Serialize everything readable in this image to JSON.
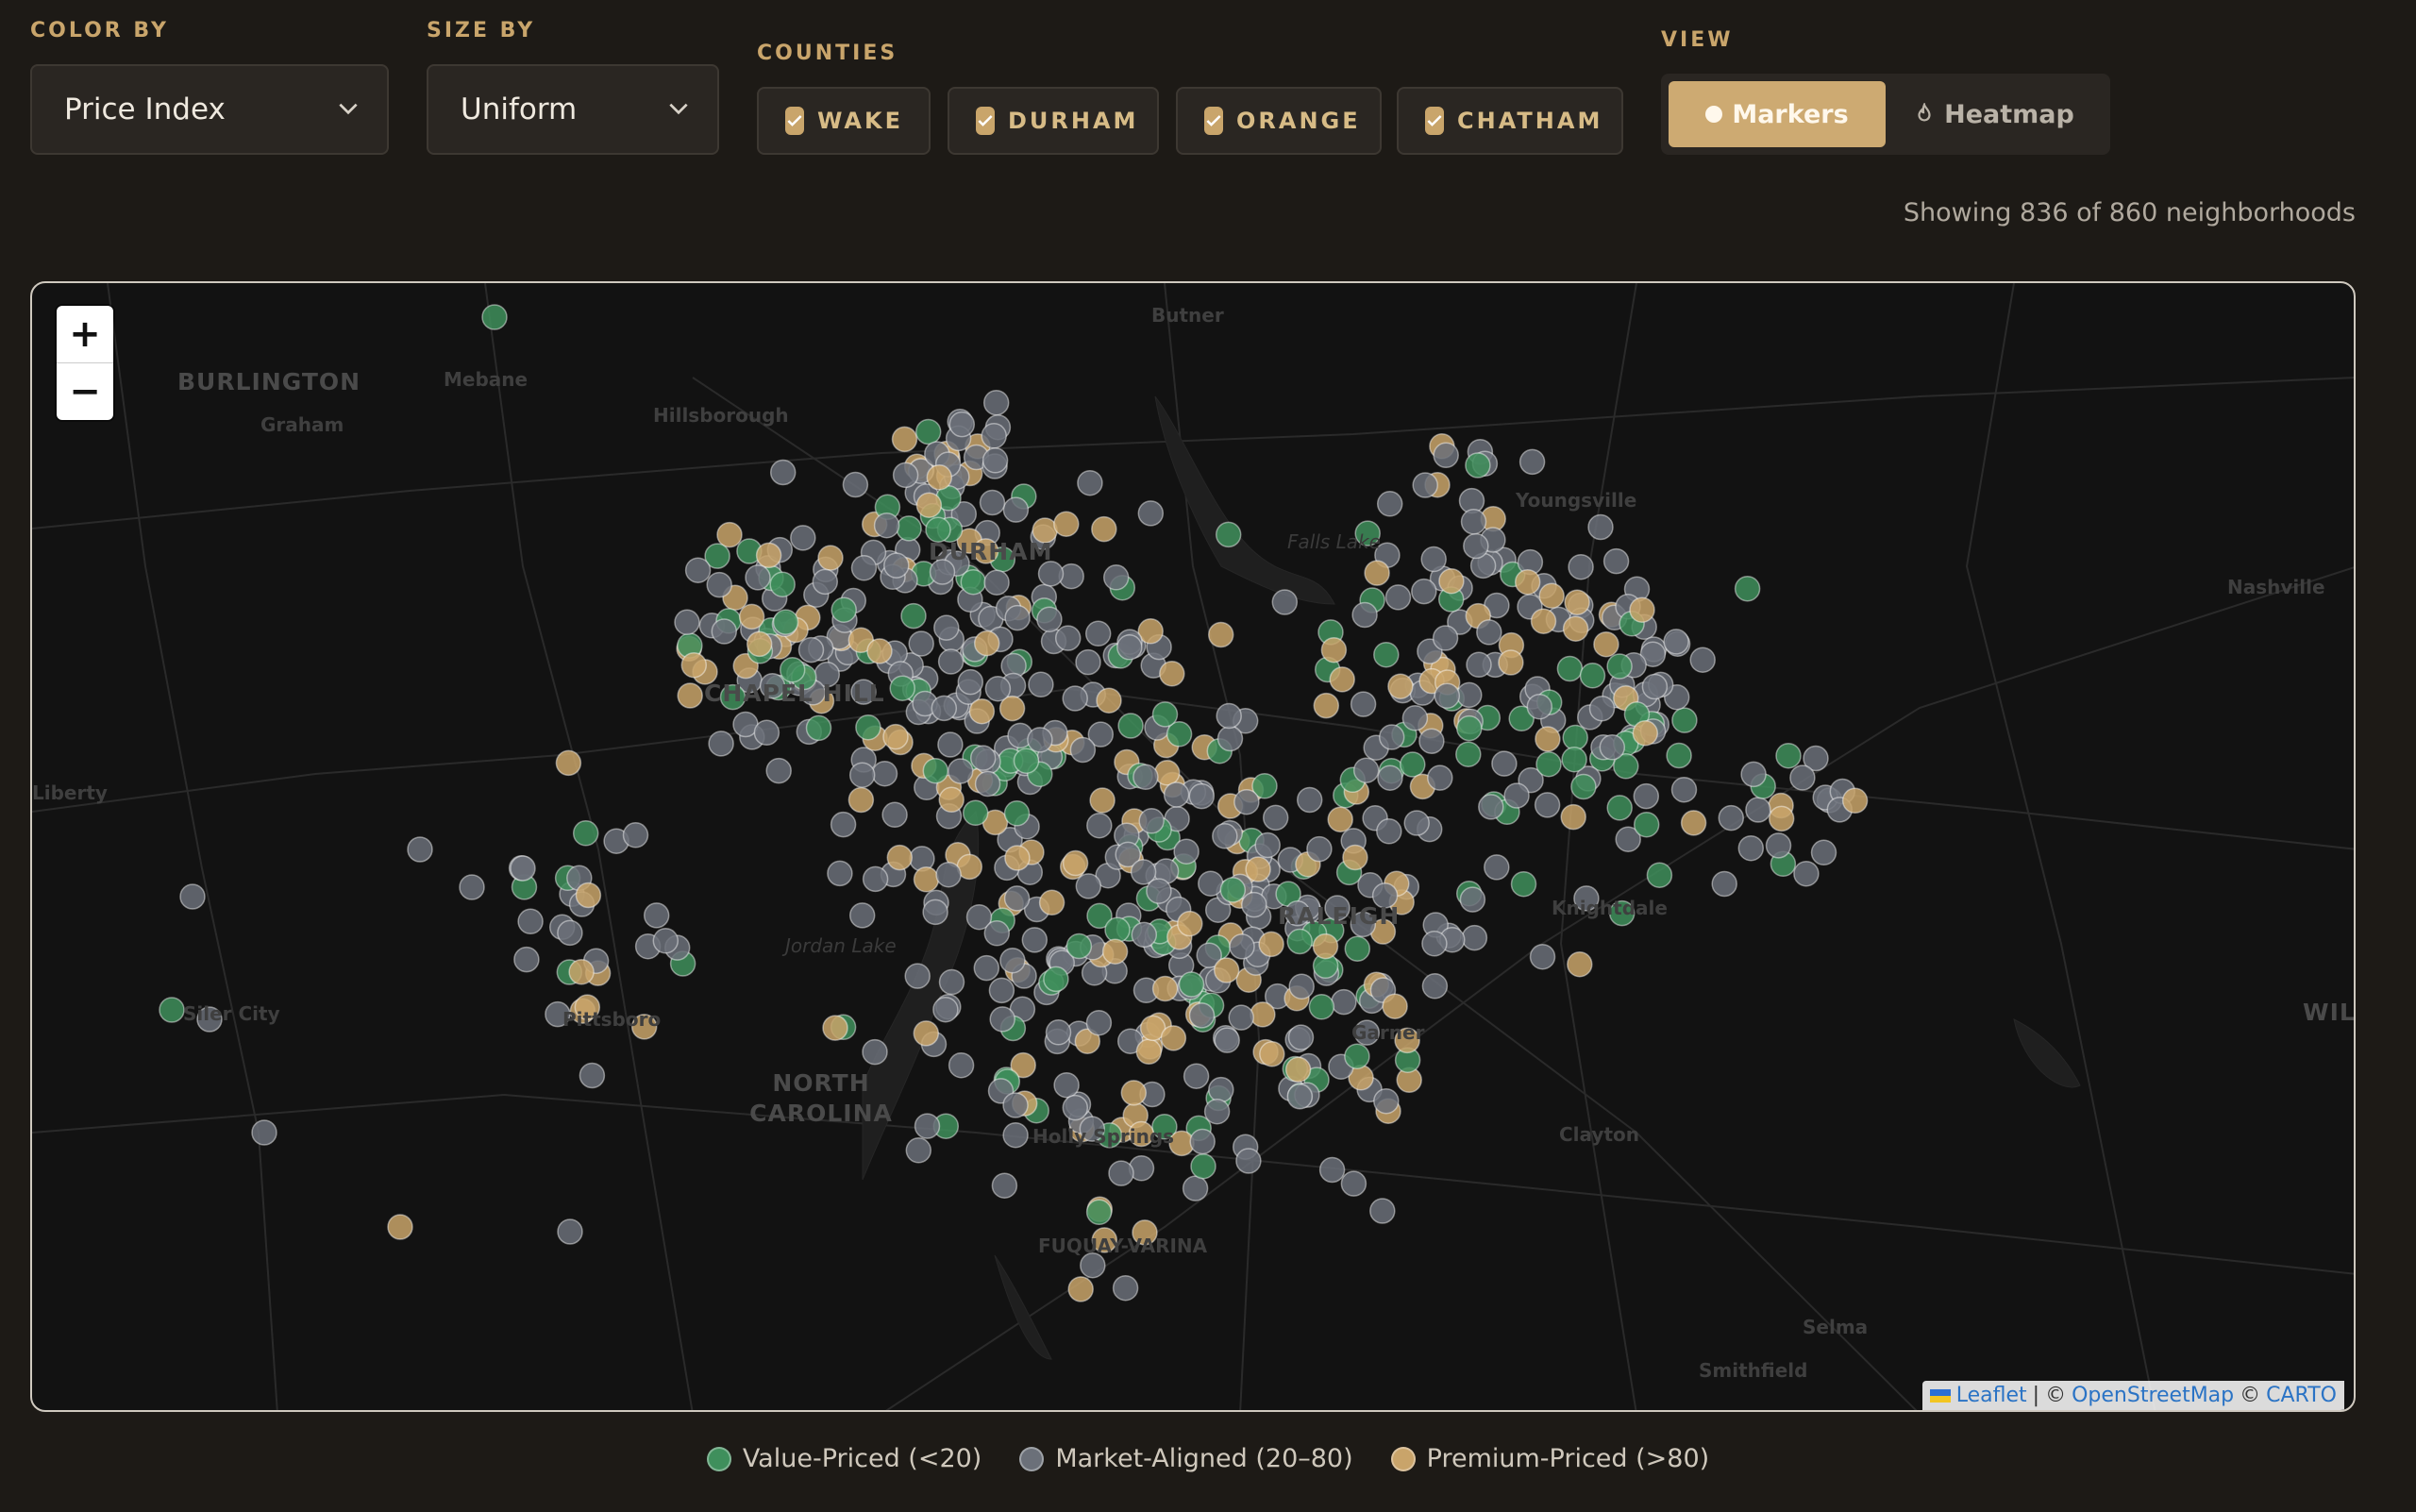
{
  "controls": {
    "color_by": {
      "label": "COLOR BY",
      "value": "Price Index"
    },
    "size_by": {
      "label": "SIZE BY",
      "value": "Uniform"
    },
    "counties": {
      "label": "COUNTIES",
      "items": [
        "WAKE",
        "DURHAM",
        "ORANGE",
        "CHATHAM"
      ]
    },
    "view": {
      "label": "VIEW",
      "markers": "Markers",
      "heatmap": "Heatmap",
      "active": "Markers"
    }
  },
  "status": {
    "count_text": "Showing 836 of 860 neighborhoods"
  },
  "map": {
    "zoom_in": "+",
    "zoom_out": "−",
    "attribution": {
      "leaflet": "Leaflet",
      "sep": "|",
      "copy1": "©",
      "osm": "OpenStreetMap",
      "copy2": "©",
      "carto": "CARTO"
    },
    "places": [
      "Butner",
      "BURLINGTON",
      "Graham",
      "Mebane",
      "Hillsborough",
      "Youngsville",
      "Falls Lake",
      "Nashville",
      "Liberty",
      "CHAPEL HILL",
      "DURHAM",
      "RALEIGH",
      "Jordan Lake",
      "Siler City",
      "Pittsboro",
      "NORTH CAROLINA",
      "Garner",
      "Clayton",
      "Holly Springs",
      "FUQUAY-VARINA",
      "Knightdale",
      "Selma",
      "Smithfield",
      "WILSON"
    ]
  },
  "colors": {
    "value": "#3f8f5c",
    "market": "#6b7079",
    "premium": "#c9a46a",
    "accent": "#cdaa72"
  },
  "legend": [
    {
      "label": "Value-Priced (<20)",
      "color": "#3f8f5c"
    },
    {
      "label": "Market-Aligned (20–80)",
      "color": "#6b7079"
    },
    {
      "label": "Premium-Priced (>80)",
      "color": "#c9a46a"
    }
  ]
}
